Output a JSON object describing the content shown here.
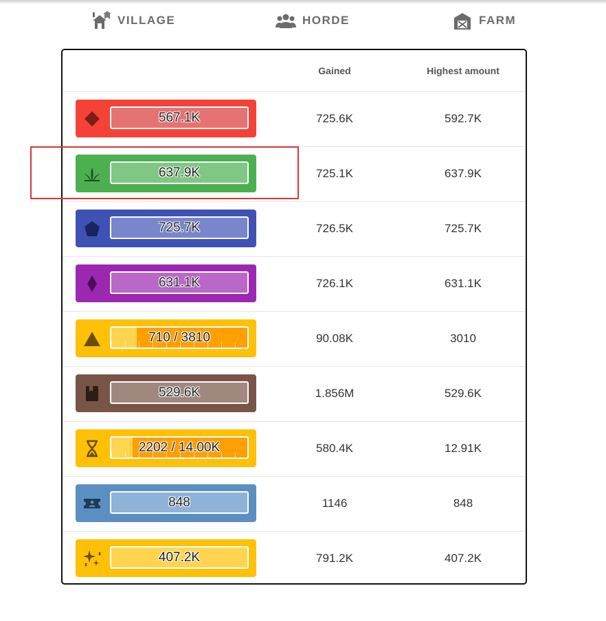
{
  "nav": {
    "tabs": [
      {
        "label": "VILLAGE",
        "icon": "village-icon"
      },
      {
        "label": "HORDE",
        "icon": "people-icon"
      },
      {
        "label": "FARM",
        "icon": "barn-icon"
      }
    ]
  },
  "table": {
    "headers": {
      "gained": "Gained",
      "highest": "Highest amount"
    },
    "rows": [
      {
        "icon": "diamond-icon",
        "value": "567.1K",
        "gained": "725.6K",
        "highest": "592.7K",
        "progress": null,
        "colors": {
          "chip": "#f44336",
          "bar": "#e57373",
          "icon": "#7b1f15"
        }
      },
      {
        "icon": "grass-icon",
        "value": "637.9K",
        "gained": "725.1K",
        "highest": "637.9K",
        "progress": null,
        "colors": {
          "chip": "#4caf50",
          "bar": "#81c784",
          "icon": "#1b4d1f"
        }
      },
      {
        "icon": "pentagon-icon",
        "value": "725.7K",
        "gained": "726.5K",
        "highest": "725.7K",
        "progress": null,
        "colors": {
          "chip": "#3f51b5",
          "bar": "#7986cb",
          "icon": "#1a2460"
        }
      },
      {
        "icon": "gem-icon",
        "value": "631.1K",
        "gained": "726.1K",
        "highest": "631.1K",
        "progress": null,
        "colors": {
          "chip": "#9c27b0",
          "bar": "#ba68c8",
          "icon": "#4a0f57"
        }
      },
      {
        "icon": "triangle-icon",
        "value": "710 / 3810",
        "gained": "90.08K",
        "highest": "3010",
        "progress": 0.186,
        "colors": {
          "chip": "#ffc107",
          "bar": "#ffa000",
          "fill": "#ffd54f",
          "icon": "#6b4f00"
        }
      },
      {
        "icon": "bookmark-icon",
        "value": "529.6K",
        "gained": "1.856M",
        "highest": "529.6K",
        "progress": null,
        "colors": {
          "chip": "#795548",
          "bar": "#a1887f",
          "icon": "#2e1d17"
        }
      },
      {
        "icon": "hourglass-icon",
        "value": "2202 / 14.00K",
        "gained": "580.4K",
        "highest": "12.91K",
        "progress": 0.157,
        "colors": {
          "chip": "#ffc107",
          "bar": "#ffa000",
          "fill": "#ffd54f",
          "icon": "#6b4f00"
        }
      },
      {
        "icon": "ticket-icon",
        "value": "848",
        "gained": "1146",
        "highest": "848",
        "progress": null,
        "colors": {
          "chip": "#5b8fc1",
          "bar": "#8fb3d8",
          "icon": "#1f3a57"
        }
      },
      {
        "icon": "sparkle-icon",
        "value": "407.2K",
        "gained": "791.2K",
        "highest": "407.2K",
        "progress": null,
        "colors": {
          "chip": "#ffc107",
          "bar": "#ffd54f",
          "icon": "#6b4f00"
        }
      }
    ]
  }
}
